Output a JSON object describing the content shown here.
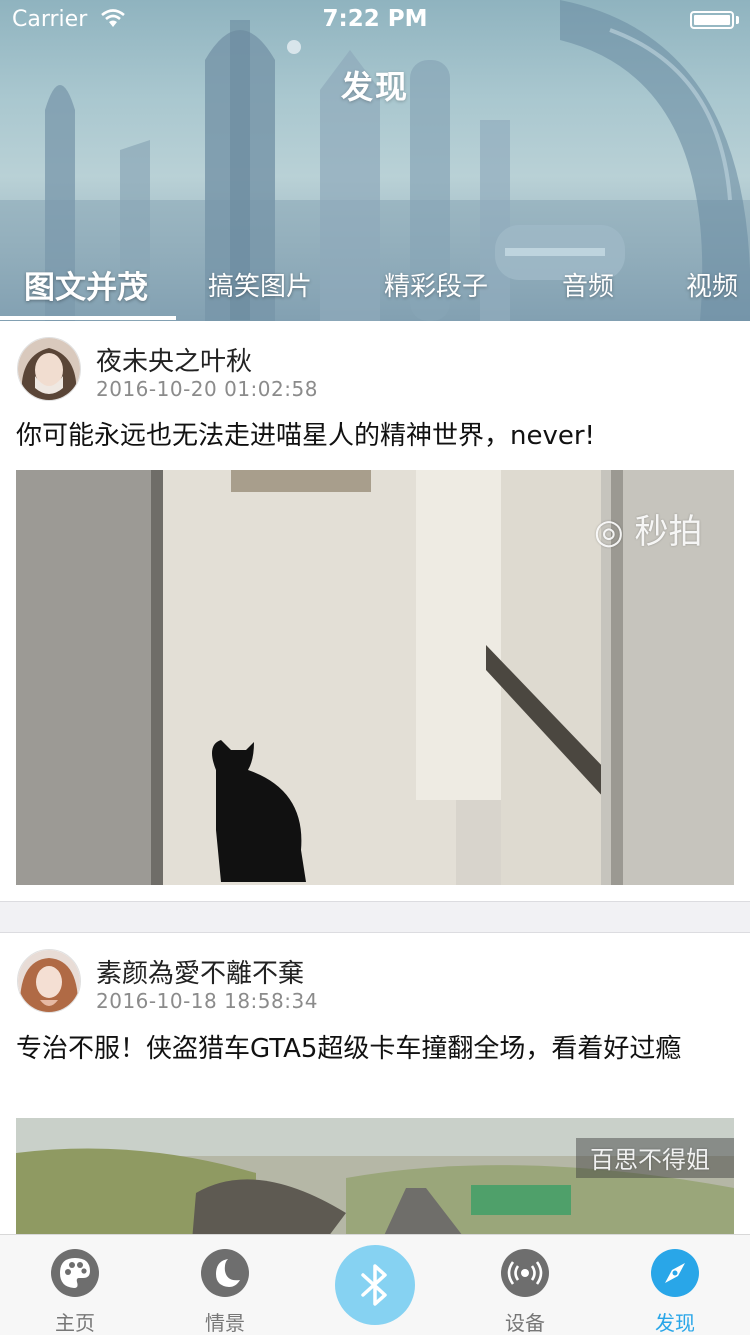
{
  "status_bar": {
    "carrier": "Carrier",
    "time": "7:22 PM"
  },
  "header": {
    "title": "发现"
  },
  "tabs": [
    {
      "label": "图文并茂",
      "active": true
    },
    {
      "label": "搞笑图片",
      "active": false
    },
    {
      "label": "精彩段子",
      "active": false
    },
    {
      "label": "音频",
      "active": false
    },
    {
      "label": "视频",
      "active": false
    }
  ],
  "posts": [
    {
      "username": "夜未央之叶秋",
      "time": "2016-10-20 01:02:58",
      "text": "你可能永远也无法走进喵星人的精神世界，never!",
      "watermark": "秒拍"
    },
    {
      "username": "素颜為愛不離不棄",
      "time": "2016-10-18 18:58:34",
      "text": "专治不服！侠盗猎车GTA5超级卡车撞翻全场，看着好过瘾",
      "watermark": "百思不得姐"
    }
  ],
  "tabbar": {
    "items": [
      {
        "label": "主页",
        "icon": "palette-icon"
      },
      {
        "label": "情景",
        "icon": "moon-icon"
      },
      {
        "label": "",
        "icon": "bluetooth-icon"
      },
      {
        "label": "设备",
        "icon": "broadcast-icon"
      },
      {
        "label": "发现",
        "icon": "compass-icon",
        "active": true
      }
    ]
  },
  "colors": {
    "accent": "#29a6e8",
    "bluetooth": "#86d2f2",
    "inactive": "#6e6e6e"
  }
}
